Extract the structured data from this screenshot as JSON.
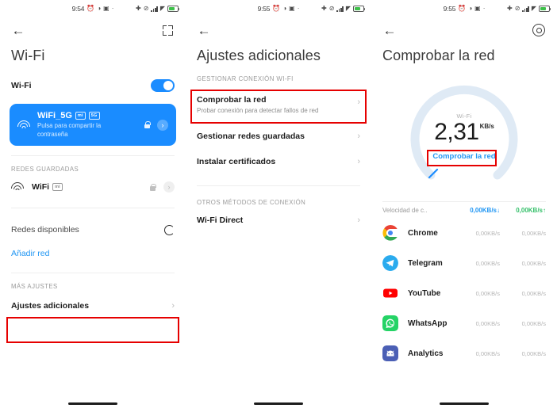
{
  "panels": [
    {
      "status": {
        "time": "9:54",
        "icons": [
          "alarm-icon",
          "headset-icon",
          "vibrate-icon",
          "dot-icon"
        ],
        "right_icons": [
          "bluetooth-icon",
          "mute-icon",
          "signal-icon",
          "wifi-icon",
          "battery-icon"
        ]
      },
      "appbar": {
        "back": "back-arrow-icon",
        "action": "scan-icon"
      },
      "title": "Wi-Fi",
      "wifi_toggle": {
        "label": "Wi-Fi",
        "state": "on"
      },
      "connected": {
        "ssid": "WiFi_5G",
        "badges": [
          "mi",
          "5G"
        ],
        "subtitle": "Pulsa para compartir la contraseña",
        "lock": "lock-icon",
        "chevron": "chevron-right-icon"
      },
      "saved_header": "REDES GUARDADAS",
      "saved": [
        {
          "ssid": "WiFi",
          "badge": "mi"
        }
      ],
      "available_label": "Redes disponibles",
      "add_network": "Añadir red",
      "more_header": "MÁS AJUSTES",
      "more_item": "Ajustes adicionales"
    },
    {
      "status": {
        "time": "9:55"
      },
      "appbar": {
        "back": "back-arrow-icon"
      },
      "title": "Ajustes adicionales",
      "section1_header": "GESTIONAR CONEXIÓN WI-FI",
      "items": [
        {
          "title": "Comprobar la red",
          "subtitle": "Probar conexión para detectar fallos de red"
        },
        {
          "title": "Gestionar redes guardadas",
          "subtitle": ""
        },
        {
          "title": "Instalar certificados",
          "subtitle": ""
        }
      ],
      "section2_header": "OTROS MÉTODOS DE CONEXIÓN",
      "items2": [
        {
          "title": "Wi-Fi Direct",
          "subtitle": ""
        }
      ]
    },
    {
      "status": {
        "time": "9:55"
      },
      "appbar": {
        "back": "back-arrow-icon",
        "action": "gear-icon"
      },
      "title": "Comprobar la red",
      "gauge": {
        "label": "Wi-Fi",
        "value": "2,31",
        "unit": "KB/s",
        "action": "Comprobar la red"
      },
      "speed_header": {
        "label": "Velocidad de c..",
        "download": "0,00KB/s",
        "upload": "0,00KB/s",
        "down_arrow": "↓",
        "up_arrow": "↑"
      },
      "apps": [
        {
          "name": "Chrome",
          "icon": "chrome-icon",
          "down": "0,00KB/s",
          "up": "0,00KB/s"
        },
        {
          "name": "Telegram",
          "icon": "telegram-icon",
          "down": "0,00KB/s",
          "up": "0,00KB/s"
        },
        {
          "name": "YouTube",
          "icon": "youtube-icon",
          "down": "0,00KB/s",
          "up": "0,00KB/s"
        },
        {
          "name": "WhatsApp",
          "icon": "whatsapp-icon",
          "down": "0,00KB/s",
          "up": "0,00KB/s"
        },
        {
          "name": "Analytics",
          "icon": "analytics-icon",
          "down": "0,00KB/s",
          "up": "0,00KB/s"
        }
      ]
    }
  ],
  "colors": {
    "accent_blue": "#1a8cff",
    "link_blue": "#2196f3",
    "green": "#35c06a",
    "highlight_red": "#e60000",
    "gauge_track": "#dce9f5"
  }
}
